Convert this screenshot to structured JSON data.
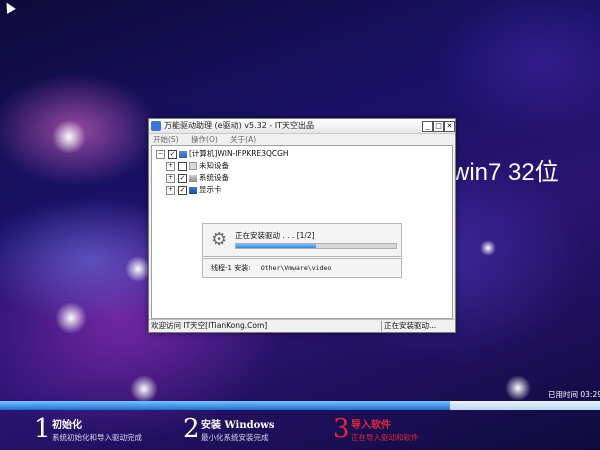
{
  "desktop": {
    "os_label": "win7 32位",
    "elapsed_label": "已用时间 03:29"
  },
  "window": {
    "title": "万能驱动助理 (e驱动) v5.32 - IT天空出品",
    "menu": [
      "开始(S)",
      "操作(O)",
      "关于(A)"
    ],
    "tree": [
      {
        "label": "[计算机]WIN-IFPKRE3QCGH",
        "level": 0,
        "checked": true
      },
      {
        "label": "未知设备",
        "level": 1,
        "checked": false
      },
      {
        "label": "系统设备",
        "level": 1,
        "checked": true
      },
      {
        "label": "显示卡",
        "level": 1,
        "checked": true
      }
    ],
    "progress": {
      "status": "正在安装驱动 . . . [1/2]",
      "fraction": 0.5
    },
    "thread": {
      "label": "线程-1 安装:",
      "path": "Other\\Vmware\\video"
    },
    "statusbar": {
      "left": "欢迎访问 IT天空[ITianKong.Com]",
      "right": "正在安装驱动..."
    }
  },
  "main_progress": {
    "fraction": 0.75
  },
  "steps": [
    {
      "num": "1",
      "title": "初始化",
      "desc": "系统初始化和导入驱动完成"
    },
    {
      "num": "2",
      "title": "安装 Windows",
      "desc": "最小化系统安装完成"
    },
    {
      "num": "3",
      "title": "导入软件",
      "desc": "正在导入驱动和软件"
    }
  ],
  "colors": {
    "active_step": "#e02a3a",
    "progress_blue": "#2f8ae0"
  },
  "icons": {
    "gear": "gear-icon",
    "computer": "computer-icon"
  }
}
